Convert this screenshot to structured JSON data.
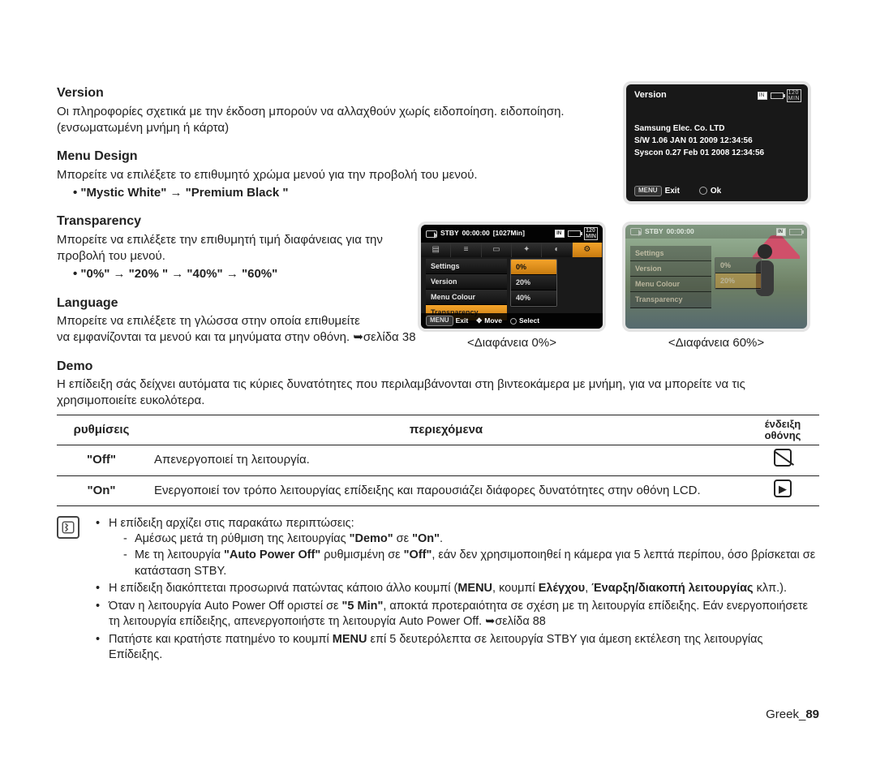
{
  "sections": {
    "version": {
      "heading": "Version",
      "text": "Οι πληροφορίες σχετικά με την έκδοση μπορούν να αλλαχθούν χωρίς ειδοποίηση. ειδοποίηση.(ενσωματωμένη μνήμη ή κάρτα)"
    },
    "menu_design": {
      "heading": "Menu Design",
      "text": "Μπορείτε να επιλέξετε το επιθυμητό χρώμα μενού για την προβολή του μενού.",
      "bullet_parts": {
        "a": "\"Mystic White\"",
        "sep": " → ",
        "b": "\"Premium Black \""
      }
    },
    "transparency": {
      "heading": "Transparency",
      "text": "Μπορείτε να επιλέξετε την επιθυμητή τιμή διαφάνειας για την προβολή του μενού.",
      "bullet": "\"0%\" → \"20% \" → \"40%\" → \"60%\""
    },
    "language": {
      "heading": "Language",
      "text1": "Μπορείτε να επιλέξετε τη γλώσσα στην οποία επιθυμείτε",
      "text2": "να εμφανίζονται τα μενού και τα μηνύματα στην οθόνη. ➥σελίδα 38"
    },
    "demo": {
      "heading": "Demo",
      "text": "Η επίδειξη σάς δείχνει αυτόματα τις κύριες δυνατότητες που περιλαμβάνονται στη βιντεοκάμερα με μνήμη, για να μπορείτε να τις χρησιμοποιείτε ευκολότερα."
    }
  },
  "version_panel": {
    "title": "Version",
    "in_label": "IN",
    "min_label": "120\nMIN",
    "line1": "Samsung Elec. Co. LTD",
    "line2": "S/W 1.06 JAN 01 2009 12:34:56",
    "line3": "Syscon 0.27 Feb 01 2008 12:34:56",
    "exit_btn": "MENU",
    "exit_label": "Exit",
    "ok_label": "Ok"
  },
  "stby_left": {
    "stby": "STBY",
    "time": "00:00:00",
    "remain": "[1027Min]",
    "menu": {
      "settings": "Settings",
      "version": "Version",
      "menu_colour": "Menu Colour",
      "transparency": "Transparency"
    },
    "popout": {
      "p0": "0%",
      "p20": "20%",
      "p40": "40%"
    },
    "bottom": {
      "exit_btn": "MENU",
      "exit": "Exit",
      "move": "Move",
      "select": "Select"
    },
    "caption": "<Διαφάνεια 0%>"
  },
  "stby_right": {
    "caption": "<Διαφάνεια 60%>"
  },
  "table": {
    "h_settings": "ρυθμίσεις",
    "h_contents": "περιεχόμενα",
    "h_indicator": "ένδειξη\nοθόνης",
    "rows": {
      "off": {
        "label": "\"Off\"",
        "desc": "Απενεργοποιεί τη λειτουργία."
      },
      "on": {
        "label": "\"On\"",
        "desc": "Ενεργοποιεί τον τρόπο λειτουργίας επίδειξης και παρουσιάζει διάφορες δυνατότητες στην οθόνη LCD."
      }
    }
  },
  "notes": {
    "n1": "Η επίδειξη αρχίζει στις παρακάτω περιπτώσεις:",
    "n1a_pre": "Αμέσως μετά τη ρύθμιση της λειτουργίας ",
    "n1a_b1": "\"Demo\"",
    "n1a_mid": " σε ",
    "n1a_b2": "\"On\"",
    "n1a_post": ".",
    "n1b_pre": "Με τη λειτουργία ",
    "n1b_b1": "\"Auto Power Off\"",
    "n1b_mid": " ρυθμισμένη σε ",
    "n1b_b2": "\"Off\"",
    "n1b_post": ", εάν δεν χρησιμοποιηθεί η κάμερα για 5 λεπτά περίπου, όσο βρίσκεται σε κατάσταση STBY.",
    "n2_pre": "Η επίδειξη διακόπτεται προσωρινά πατώντας κάποιο άλλο κουμπί (",
    "n2_b1": "MENU",
    "n2_mid1": ", κουμπί ",
    "n2_b2": "Ελέγχου",
    "n2_mid2": ", ",
    "n2_b3": "Έναρξη/διακοπή λειτουργίας",
    "n2_post": " κλπ.).",
    "n3_pre": "Όταν η λειτουργία Auto Power Off οριστεί σε ",
    "n3_b1": "\"5 Min\"",
    "n3_post": ", αποκτά προτεραιότητα σε σχέση με τη λειτουργία επίδειξης. Εάν ενεργοποιήσετε τη λειτουργία επίδειξης, απενεργοποιήστε τη λειτουργία Auto Power Off. ➥σελίδα 88",
    "n4_pre": "Πατήστε και κρατήστε πατημένο το κουμπί ",
    "n4_b1": "MENU",
    "n4_post": " επί 5 δευτερόλεπτα σε λειτουργία STBY για άμεση εκτέλεση της λειτουργίας Επίδειξης."
  },
  "footer": {
    "lang": "Greek",
    "num": "89",
    "sep": "_"
  }
}
